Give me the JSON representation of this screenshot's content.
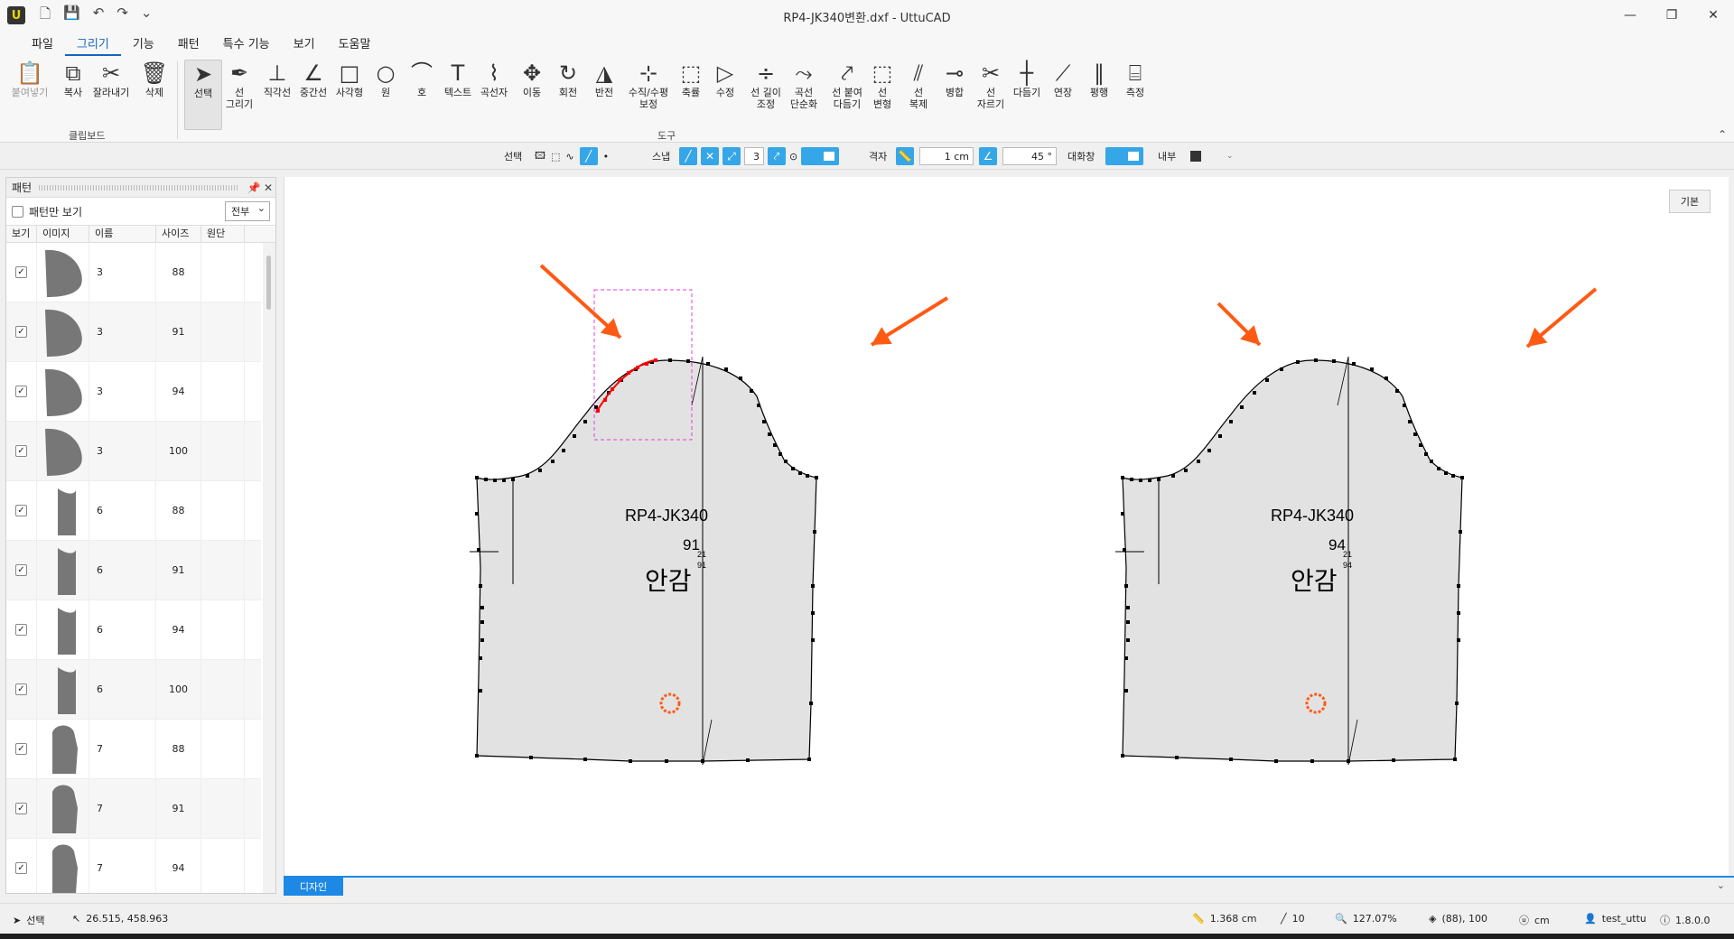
{
  "window": {
    "title": "RP4-JK340변환.dxf - UttuCAD",
    "app_icon": "U"
  },
  "menu": [
    "파일",
    "그리기",
    "기능",
    "패턴",
    "특수 기능",
    "보기",
    "도움말"
  ],
  "ribbon": {
    "clipboard": [
      {
        "label": "붙여넣기",
        "icon": "paste-icon",
        "glyph": "📋",
        "disabled": true
      },
      {
        "label": "복사",
        "icon": "copy-icon",
        "glyph": "⧉"
      },
      {
        "label": "잘라내기",
        "icon": "scissors-icon",
        "glyph": "✂"
      },
      {
        "label": "삭제",
        "icon": "trash-icon",
        "glyph": "🗑"
      }
    ],
    "clipboard_group": "클립보드",
    "tools": [
      {
        "label": "선택",
        "icon": "select-arrow-icon",
        "glyph": "➤",
        "selected": true
      },
      {
        "label": "선\n그리기",
        "icon": "pen-icon",
        "glyph": "✒"
      },
      {
        "label": "직각선",
        "icon": "perpendicular-icon",
        "glyph": "⊥"
      },
      {
        "label": "중간선",
        "icon": "midline-icon",
        "glyph": "∠"
      },
      {
        "label": "사각형",
        "icon": "rectangle-icon",
        "glyph": "□"
      },
      {
        "label": "원",
        "icon": "circle-icon",
        "glyph": "○"
      },
      {
        "label": "호",
        "icon": "arc-icon",
        "glyph": "⌒"
      },
      {
        "label": "텍스트",
        "icon": "text-icon",
        "glyph": "T"
      },
      {
        "label": "곡선자",
        "icon": "curve-ruler-icon",
        "glyph": "⌇"
      },
      {
        "label": "이동",
        "icon": "move-icon",
        "glyph": "✥"
      },
      {
        "label": "회전",
        "icon": "rotate-icon",
        "glyph": "↻"
      },
      {
        "label": "반전",
        "icon": "mirror-icon",
        "glyph": "◮"
      },
      {
        "label": "수직/수평\n보정",
        "icon": "axis-correct-icon",
        "glyph": "⊹"
      },
      {
        "label": "축률",
        "icon": "scale-icon",
        "glyph": "⬚"
      },
      {
        "label": "수정",
        "icon": "edit-node-icon",
        "glyph": "▷"
      },
      {
        "label": "선 길이\n조정",
        "icon": "line-length-icon",
        "glyph": "÷"
      },
      {
        "label": "곡선\n단순화",
        "icon": "simplify-curve-icon",
        "glyph": "⤳"
      },
      {
        "label": "선 붙여\n다듬기",
        "icon": "join-line-icon",
        "glyph": "⤤"
      },
      {
        "label": "선\n변형",
        "icon": "line-transform-icon",
        "glyph": "⬚"
      },
      {
        "label": "선\n복제",
        "icon": "line-duplicate-icon",
        "glyph": "⫽"
      },
      {
        "label": "병합",
        "icon": "merge-icon",
        "glyph": "⊸"
      },
      {
        "label": "선\n자르기",
        "icon": "cut-line-icon",
        "glyph": "✂"
      },
      {
        "label": "다듬기",
        "icon": "trim-icon",
        "glyph": "┼"
      },
      {
        "label": "연장",
        "icon": "extend-icon",
        "glyph": "⟋"
      },
      {
        "label": "평행",
        "icon": "parallel-icon",
        "glyph": "∥"
      },
      {
        "label": "측정",
        "icon": "measure-tape-icon",
        "glyph": "⌸"
      }
    ],
    "tools_group": "도구"
  },
  "options": {
    "select_label": "선택",
    "snap_label": "스냅",
    "snap_value": "3",
    "grid_label": "격자",
    "grid_value": "1 cm",
    "angle_value": "45 °",
    "dialog_label": "대화창",
    "inner_label": "내부"
  },
  "panel": {
    "title": "패턴",
    "pattern_only_label": "패턴만 보기",
    "filter": "전부",
    "columns": [
      "보기",
      "이미지",
      "이름",
      "사이즈",
      "원단"
    ],
    "rows": [
      {
        "name": "3",
        "size": "88",
        "shape": "d"
      },
      {
        "name": "3",
        "size": "91",
        "shape": "d"
      },
      {
        "name": "3",
        "size": "94",
        "shape": "d"
      },
      {
        "name": "3",
        "size": "100",
        "shape": "d"
      },
      {
        "name": "6",
        "size": "88",
        "shape": "strip"
      },
      {
        "name": "6",
        "size": "91",
        "shape": "strip"
      },
      {
        "name": "6",
        "size": "94",
        "shape": "strip"
      },
      {
        "name": "6",
        "size": "100",
        "shape": "strip"
      },
      {
        "name": "7",
        "size": "88",
        "shape": "sleeve"
      },
      {
        "name": "7",
        "size": "91",
        "shape": "sleeve"
      },
      {
        "name": "7",
        "size": "94",
        "shape": "sleeve"
      }
    ]
  },
  "canvas": {
    "default_button": "기본",
    "patterns": [
      {
        "name": "RP4-JK340",
        "size": "91",
        "small_a": "21",
        "small_b": "91",
        "label": "안감"
      },
      {
        "name": "RP4-JK340",
        "size": "94",
        "small_a": "21",
        "small_b": "94",
        "label": "안감"
      }
    ],
    "colors": {
      "fill": "#e2e2e2",
      "highlight": "#ff0000",
      "selection_box": "#e040e0",
      "arrow": "#ff5a14"
    }
  },
  "tab": {
    "label": "디자인"
  },
  "status": {
    "mode": "선택",
    "coords": "26.515, 458.963",
    "length": "1.368 cm",
    "count": "10",
    "zoom": "127.07%",
    "size_info": "(88), 100",
    "unit": "cm",
    "user": "test_uttu",
    "version": "1.8.0.0"
  }
}
